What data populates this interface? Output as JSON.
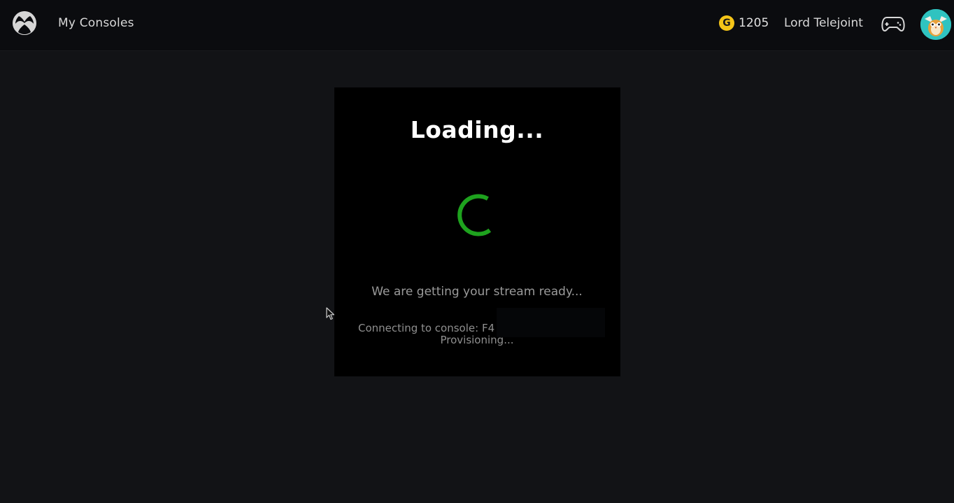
{
  "header": {
    "title": "My Consoles",
    "gamerscore_badge": "G",
    "gamerscore": "1205",
    "username": "Lord Telejoint"
  },
  "dialog": {
    "title": "Loading...",
    "status": "We are getting your stream ready...",
    "connecting": "Connecting to console: F4",
    "provisioning": "Provisioning..."
  },
  "colors": {
    "accent": "#1ea21e",
    "gold": "#f5c518",
    "avatar_bg": "#2fc3c0"
  },
  "icons": {
    "logo": "xbox-logo-icon",
    "controller": "controller-icon",
    "avatar": "owl-avatar",
    "spinner": "loading-spinner",
    "cursor": "mouse-cursor-icon"
  }
}
